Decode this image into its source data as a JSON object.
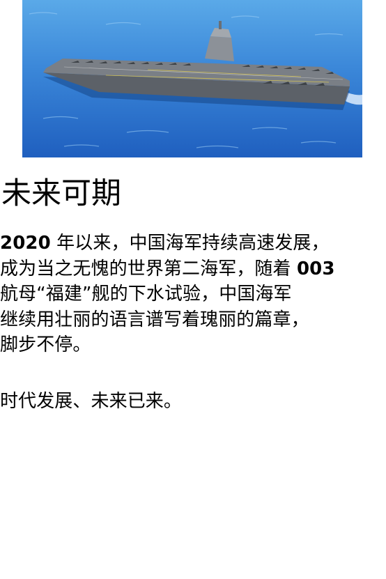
{
  "article": {
    "image": {
      "subject": "aircraft-carrier",
      "colors": {
        "sea_light": "#4fa6e6",
        "sea_dark": "#1a5fbf",
        "deck": "#7a7f86",
        "hull": "#5c6168"
      }
    },
    "heading": "未来可期",
    "paragraph1": {
      "line1": {
        "year": "2020",
        "rest": " 年以来，中国海军持续高速发展，"
      },
      "line2": {
        "text": "成为当之无愧的世界第二海军，随着 ",
        "num": "003"
      },
      "line3": "航母“福建”舰的下水试验，中国海军",
      "line4": "继续用壮丽的语言谱写着瑰丽的篇章，",
      "line5": "脚步不停。"
    },
    "paragraph2": "时代发展、未来已来。"
  }
}
